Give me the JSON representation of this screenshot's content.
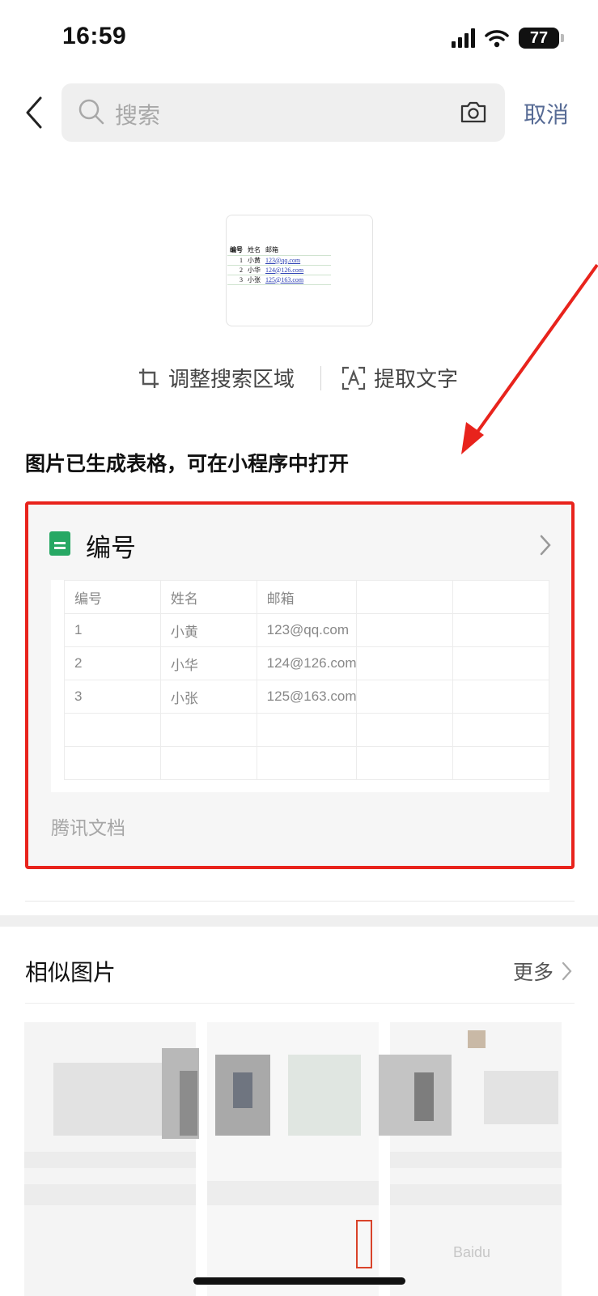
{
  "status_bar": {
    "time": "16:59",
    "battery": "77"
  },
  "search": {
    "placeholder": "搜索",
    "cancel_label": "取消"
  },
  "thumbnail": {
    "headers": [
      "编号",
      "姓名",
      "邮箱"
    ],
    "rows": [
      [
        "1",
        "小黄",
        "123@qq.com"
      ],
      [
        "2",
        "小华",
        "124@126.com"
      ],
      [
        "3",
        "小张",
        "125@163.com"
      ]
    ]
  },
  "tools": {
    "crop_label": "调整搜索区域",
    "extract_label": "提取文字"
  },
  "generated": {
    "notice": "图片已生成表格，可在小程序中打开",
    "card_title": "编号",
    "table": {
      "headers": [
        "编号",
        "姓名",
        "邮箱",
        "",
        ""
      ],
      "rows": [
        [
          "1",
          "小黄",
          "123@qq.com",
          "",
          ""
        ],
        [
          "2",
          "小华",
          "124@126.com",
          "",
          ""
        ],
        [
          "3",
          "小张",
          "125@163.com",
          "",
          ""
        ],
        [
          "",
          "",
          "",
          "",
          ""
        ],
        [
          "",
          "",
          "",
          "",
          ""
        ]
      ]
    },
    "source": "腾讯文档"
  },
  "similar": {
    "title": "相似图片",
    "more_label": "更多"
  },
  "colors": {
    "accent_link": "#576b95",
    "highlight_border": "#e8231c",
    "sheet_green": "#27a864"
  },
  "icons": [
    "back-chevron-icon",
    "search-icon",
    "camera-icon",
    "crop-icon",
    "text-extract-icon",
    "spreadsheet-icon",
    "chevron-right-icon",
    "annotation-arrow"
  ]
}
